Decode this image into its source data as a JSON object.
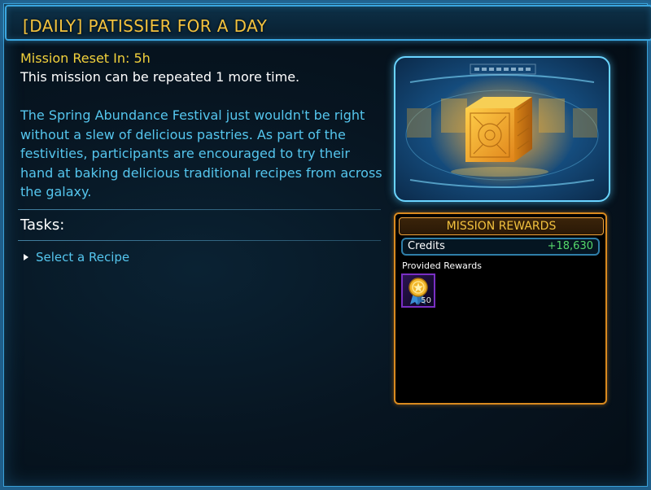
{
  "mission": {
    "title": "[DAILY] PATISSIER FOR A DAY",
    "reset_text": "Mission Reset In: 5h",
    "repeat_text": "This mission can be repeated 1 more time.",
    "description": "The Spring Abundance Festival just wouldn't be right without a slew of delicious pastries. As part of the festivities, participants are encouraged to try their hand at baking delicious traditional recipes from across the galaxy."
  },
  "tasks": {
    "label": "Tasks:",
    "items": [
      {
        "label": "Select a Recipe"
      }
    ]
  },
  "rewards": {
    "header": "MISSION REWARDS",
    "credits_label": "Credits",
    "credits_value": "+18,630",
    "provided_label": "Provided Rewards",
    "items": [
      {
        "icon": "medal-icon",
        "quantity": "50"
      }
    ]
  },
  "colors": {
    "title": "#f3c23e",
    "description": "#55c6ee",
    "credits_value": "#55d86a",
    "rewards_border": "#d98a1f",
    "frame_border": "#3aa6e0"
  }
}
